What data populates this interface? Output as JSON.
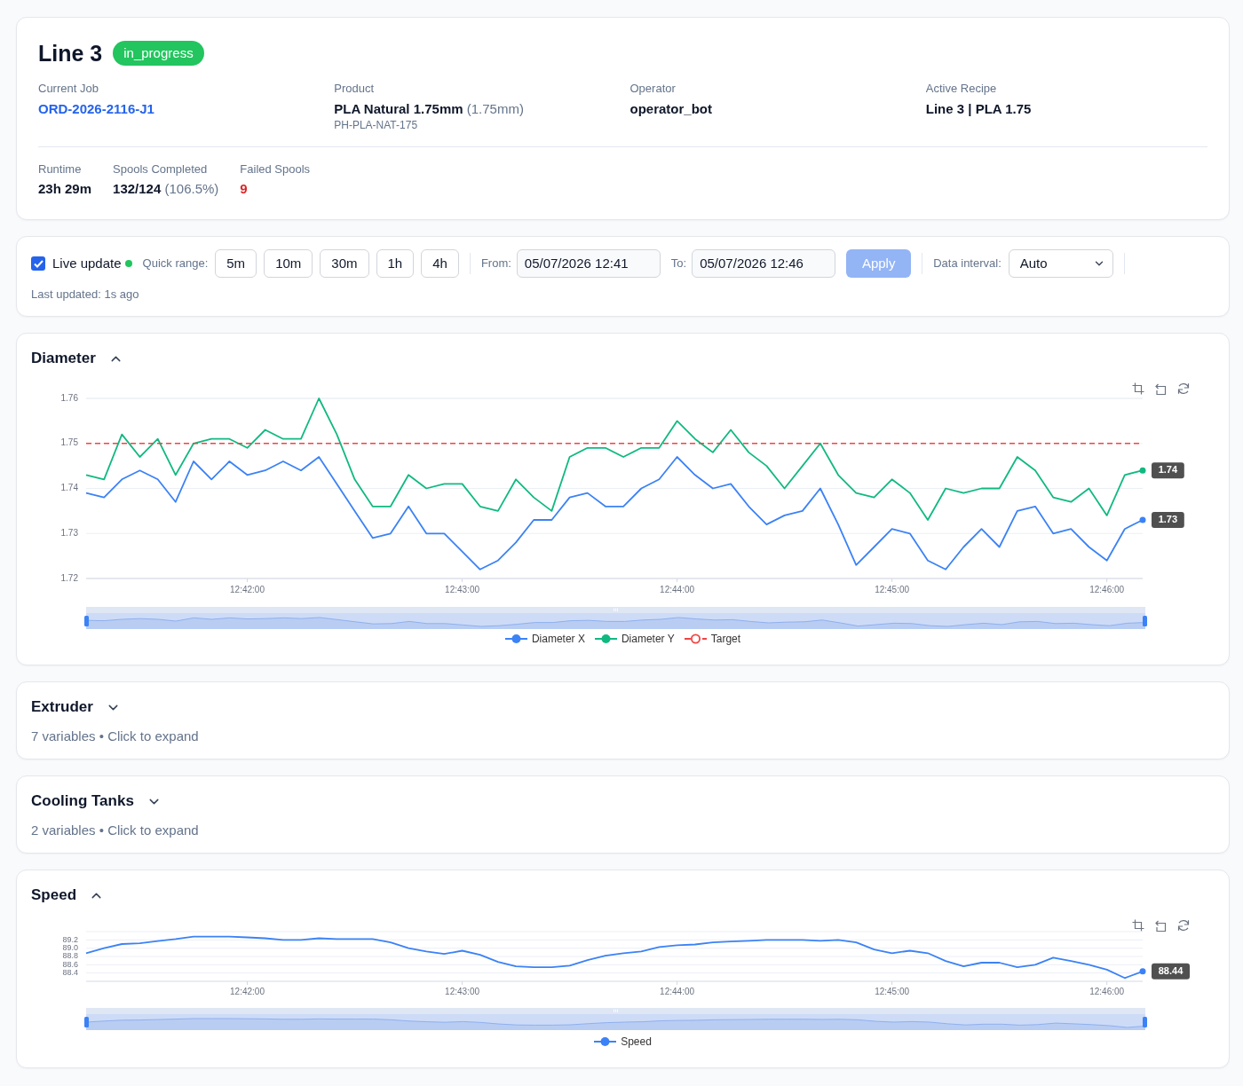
{
  "line": {
    "title": "Line 3",
    "status": {
      "label": "in_progress",
      "color": "#22c55e"
    },
    "info": [
      {
        "label": "Current Job",
        "value": "ORD-2026-2116-J1",
        "kind": "link"
      },
      {
        "label": "Product",
        "value": "PLA Natural 1.75mm",
        "note": "(1.75mm)",
        "sub": "PH-PLA-NAT-175",
        "kind": "text"
      },
      {
        "label": "Operator",
        "value": "operator_bot",
        "kind": "text"
      },
      {
        "label": "Active Recipe",
        "value": "Line 3 | PLA 1.75",
        "kind": "text"
      }
    ],
    "stats": [
      {
        "label": "Runtime",
        "value": "23h 29m",
        "kind": "text"
      },
      {
        "label": "Spools Completed",
        "value": "132/124",
        "note": "(106.5%)",
        "kind": "text"
      },
      {
        "label": "Failed Spools",
        "value": "9",
        "kind": "alert"
      }
    ]
  },
  "controls": {
    "live_update": {
      "label": "Live update",
      "checked": true,
      "connected": true
    },
    "quick_range": {
      "label": "Quick range:",
      "options": [
        {
          "label": "5m",
          "selected": false
        },
        {
          "label": "10m",
          "selected": false
        },
        {
          "label": "30m",
          "selected": false
        },
        {
          "label": "1h",
          "selected": false
        },
        {
          "label": "4h",
          "selected": false
        }
      ]
    },
    "from": {
      "label": "From:",
      "value": "05/07/2026 12:41"
    },
    "to": {
      "label": "To:",
      "value": "05/07/2026 12:46"
    },
    "apply": {
      "label": "Apply",
      "disabled": true
    },
    "interval": {
      "label": "Data interval:",
      "value": "Auto"
    },
    "last_updated": "Last updated: 1s ago"
  },
  "panels": [
    {
      "title": "Diameter",
      "expanded": true,
      "chart_data": {
        "type": "line",
        "grid": true,
        "categories": [
          null,
          null,
          null,
          null,
          null,
          null,
          null,
          null,
          null,
          "12:42:00",
          null,
          null,
          null,
          null,
          null,
          null,
          null,
          null,
          null,
          null,
          null,
          "12:43:00",
          null,
          null,
          null,
          null,
          null,
          null,
          null,
          null,
          null,
          null,
          null,
          "12:44:00",
          null,
          null,
          null,
          null,
          null,
          null,
          null,
          null,
          null,
          null,
          null,
          "12:45:00",
          null,
          null,
          null,
          null,
          null,
          null,
          null,
          null,
          null,
          null,
          null,
          "12:46:00",
          null,
          null
        ],
        "ylim": [
          1.72,
          1.76
        ],
        "yticks": [
          1.72,
          1.73,
          1.74,
          1.75,
          1.76
        ],
        "series": [
          {
            "name": "Diameter X",
            "color": "#3b82f6",
            "values": [
              1.739,
              1.738,
              1.742,
              1.744,
              1.742,
              1.737,
              1.746,
              1.742,
              1.746,
              1.743,
              1.744,
              1.746,
              1.744,
              1.747,
              1.741,
              1.735,
              1.729,
              1.73,
              1.736,
              1.73,
              1.73,
              1.726,
              1.722,
              1.724,
              1.728,
              1.733,
              1.733,
              1.738,
              1.739,
              1.736,
              1.736,
              1.74,
              1.742,
              1.747,
              1.743,
              1.74,
              1.741,
              1.736,
              1.732,
              1.734,
              1.735,
              1.74,
              1.732,
              1.723,
              1.727,
              1.731,
              1.73,
              1.724,
              1.722,
              1.727,
              1.731,
              1.727,
              1.735,
              1.736,
              1.73,
              1.731,
              1.727,
              1.724,
              1.731,
              1.733
            ]
          },
          {
            "name": "Diameter Y",
            "color": "#10b981",
            "values": [
              1.743,
              1.742,
              1.752,
              1.747,
              1.751,
              1.743,
              1.75,
              1.751,
              1.751,
              1.749,
              1.753,
              1.751,
              1.751,
              1.76,
              1.752,
              1.742,
              1.736,
              1.736,
              1.743,
              1.74,
              1.741,
              1.741,
              1.736,
              1.735,
              1.742,
              1.738,
              1.735,
              1.747,
              1.749,
              1.749,
              1.747,
              1.749,
              1.749,
              1.755,
              1.751,
              1.748,
              1.753,
              1.748,
              1.745,
              1.74,
              1.745,
              1.75,
              1.743,
              1.739,
              1.738,
              1.742,
              1.739,
              1.733,
              1.74,
              1.739,
              1.74,
              1.74,
              1.747,
              1.744,
              1.738,
              1.737,
              1.74,
              1.734,
              1.743,
              1.744
            ]
          }
        ],
        "ref_lines": [
          {
            "axis": "y",
            "value": 1.75,
            "label": "Target",
            "color": "#ef4444"
          }
        ],
        "annotations": [
          "1.73",
          "1.74"
        ]
      }
    },
    {
      "title": "Extruder",
      "expanded": false,
      "summary": "7 variables • Click to expand"
    },
    {
      "title": "Cooling Tanks",
      "expanded": false,
      "summary": "2 variables • Click to expand"
    },
    {
      "title": "Speed",
      "expanded": true,
      "chart_data": {
        "type": "line",
        "grid": true,
        "categories": [
          null,
          null,
          null,
          null,
          null,
          null,
          null,
          null,
          null,
          "12:42:00",
          null,
          null,
          null,
          null,
          null,
          null,
          null,
          null,
          null,
          null,
          null,
          "12:43:00",
          null,
          null,
          null,
          null,
          null,
          null,
          null,
          null,
          null,
          null,
          null,
          "12:44:00",
          null,
          null,
          null,
          null,
          null,
          null,
          null,
          null,
          null,
          null,
          null,
          "12:45:00",
          null,
          null,
          null,
          null,
          null,
          null,
          null,
          null,
          null,
          null,
          null,
          "12:46:00",
          null,
          null
        ],
        "ylim": [
          88.2,
          89.4
        ],
        "yticks": [
          88.4,
          88.6,
          88.8,
          {
            "value": 89,
            "label": "89.0"
          },
          89.2
        ],
        "series": [
          {
            "name": "Speed",
            "color": "#3b82f6",
            "values": [
              88.88,
              89.0,
              89.1,
              89.12,
              89.17,
              89.22,
              89.28,
              89.28,
              89.28,
              89.26,
              89.24,
              89.2,
              89.2,
              89.24,
              89.22,
              89.22,
              89.22,
              89.14,
              89.0,
              88.92,
              88.86,
              88.94,
              88.84,
              88.67,
              88.56,
              88.54,
              88.54,
              88.58,
              88.71,
              88.82,
              88.88,
              88.92,
              89.03,
              89.07,
              89.09,
              89.14,
              89.16,
              89.18,
              89.2,
              89.2,
              89.2,
              89.18,
              89.2,
              89.14,
              88.97,
              88.88,
              88.94,
              88.88,
              88.69,
              88.56,
              88.65,
              88.65,
              88.54,
              88.6,
              88.77,
              88.69,
              88.6,
              88.48,
              88.28,
              88.44
            ]
          }
        ],
        "annotations": [
          "88.44"
        ]
      }
    }
  ]
}
